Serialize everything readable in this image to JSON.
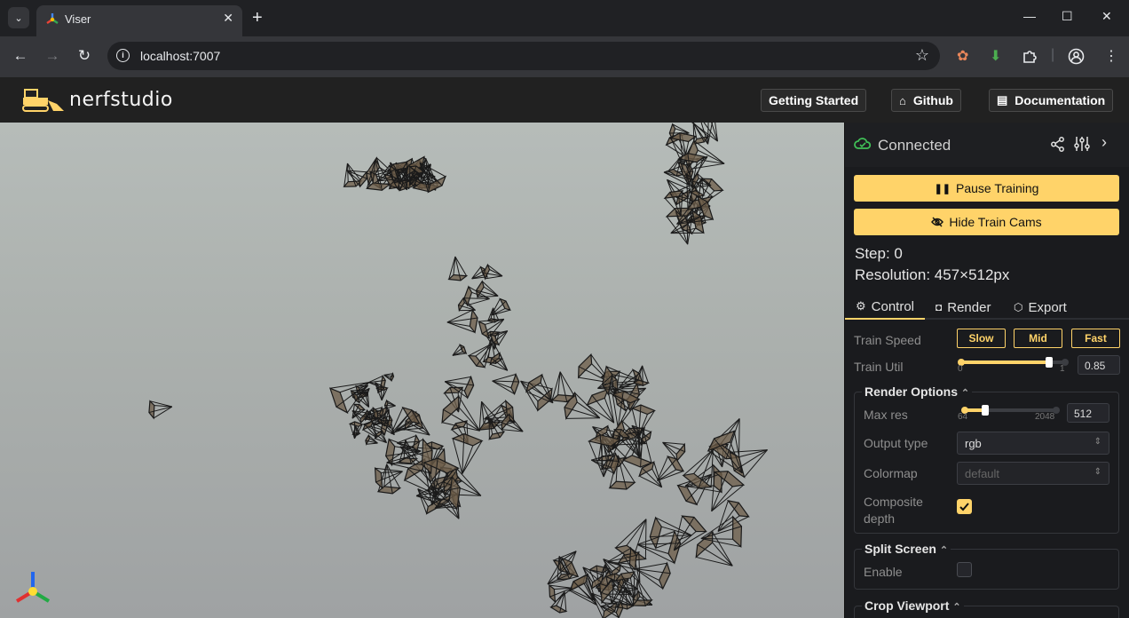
{
  "browser": {
    "tab_title": "Viser",
    "tab_close": "✕",
    "new_tab": "+",
    "url": "localhost:7007",
    "window_buttons": {
      "minimize": "—",
      "maximize": "☐",
      "close": "✕"
    }
  },
  "app": {
    "logo_text": "nerfstudio",
    "header_buttons": {
      "getting_started": "Getting Started",
      "github": "Github",
      "documentation": "Documentation"
    }
  },
  "panel": {
    "status": "Connected",
    "pause_training": "Pause Training",
    "hide_train_cams": "Hide Train Cams",
    "step": "Step: 0",
    "resolution": "Resolution: 457×512px",
    "tabs": {
      "control": "Control",
      "render": "Render",
      "export": "Export"
    },
    "train_speed": {
      "label": "Train Speed",
      "options": [
        "Slow",
        "Mid",
        "Fast"
      ]
    },
    "train_util": {
      "label": "Train Util",
      "min": "0",
      "max": "1",
      "value": "0.85",
      "fraction": 0.85
    },
    "render_options": {
      "legend": "Render Options",
      "max_res": {
        "label": "Max res",
        "min": "64",
        "max": "2048",
        "value": "512",
        "fraction": 0.226
      },
      "output_type": {
        "label": "Output type",
        "value": "rgb"
      },
      "colormap": {
        "label": "Colormap",
        "value": "default"
      },
      "composite_depth": {
        "label": "Composite depth",
        "checked": true
      }
    },
    "split_screen": {
      "legend": "Split Screen",
      "enable_label": "Enable",
      "checked": false
    },
    "crop_viewport": {
      "legend": "Crop Viewport"
    }
  },
  "colors": {
    "accent": "#ffd369",
    "connected": "#40c057"
  }
}
